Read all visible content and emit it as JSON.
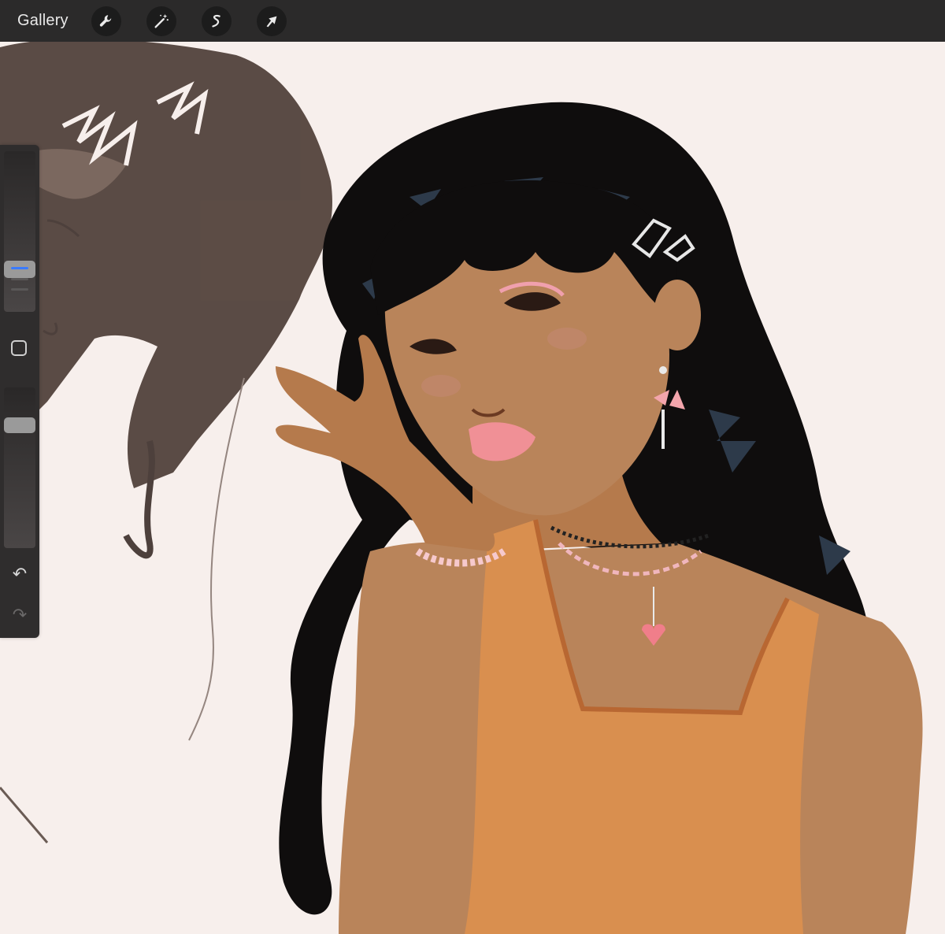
{
  "app": {
    "gallery_label": "Gallery"
  },
  "toolbar": {
    "tools": [
      {
        "name": "actions",
        "icon": "wrench-icon"
      },
      {
        "name": "adjustments",
        "icon": "magic-wand-icon"
      },
      {
        "name": "selection",
        "icon": "selection-s-icon"
      },
      {
        "name": "transform",
        "icon": "arrow-cursor-icon"
      }
    ]
  },
  "sidebar": {
    "brush_size_icon": "brush-size-slider",
    "modify_icon": "square-modify-icon",
    "opacity_icon": "opacity-slider",
    "undo_icon": "undo-arrow-icon",
    "redo_icon": "redo-arrow-icon",
    "accent_color": "#3a7bff"
  },
  "canvas": {
    "background_color": "#f7efec",
    "artwork": "illustration"
  }
}
